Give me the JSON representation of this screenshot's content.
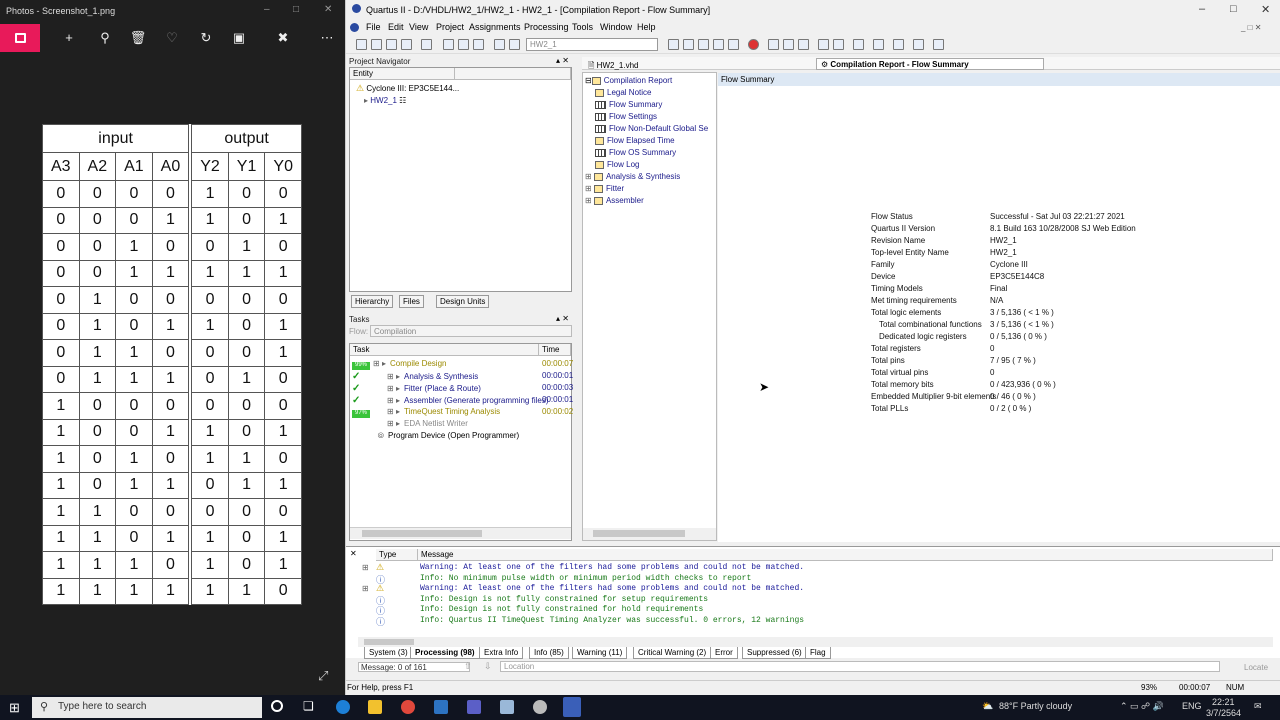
{
  "photos": {
    "title": "Photos - Screenshot_1.png",
    "table": {
      "group_headers": [
        "input",
        "output"
      ],
      "input_cols": [
        "A3",
        "A2",
        "A1",
        "A0"
      ],
      "output_cols": [
        "Y2",
        "Y1",
        "Y0"
      ],
      "rows": [
        [
          "0",
          "0",
          "0",
          "0",
          "1",
          "0",
          "0"
        ],
        [
          "0",
          "0",
          "0",
          "1",
          "1",
          "0",
          "1"
        ],
        [
          "0",
          "0",
          "1",
          "0",
          "0",
          "1",
          "0"
        ],
        [
          "0",
          "0",
          "1",
          "1",
          "1",
          "1",
          "1"
        ],
        [
          "0",
          "1",
          "0",
          "0",
          "0",
          "0",
          "0"
        ],
        [
          "0",
          "1",
          "0",
          "1",
          "1",
          "0",
          "1"
        ],
        [
          "0",
          "1",
          "1",
          "0",
          "0",
          "0",
          "1"
        ],
        [
          "0",
          "1",
          "1",
          "1",
          "0",
          "1",
          "0"
        ],
        [
          "1",
          "0",
          "0",
          "0",
          "0",
          "0",
          "0"
        ],
        [
          "1",
          "0",
          "0",
          "1",
          "1",
          "0",
          "1"
        ],
        [
          "1",
          "0",
          "1",
          "0",
          "1",
          "1",
          "0"
        ],
        [
          "1",
          "0",
          "1",
          "1",
          "0",
          "1",
          "1"
        ],
        [
          "1",
          "1",
          "0",
          "0",
          "0",
          "0",
          "0"
        ],
        [
          "1",
          "1",
          "0",
          "1",
          "1",
          "0",
          "1"
        ],
        [
          "1",
          "1",
          "1",
          "0",
          "1",
          "0",
          "1"
        ],
        [
          "1",
          "1",
          "1",
          "1",
          "1",
          "1",
          "0"
        ]
      ]
    }
  },
  "quartus": {
    "title": "Quartus II - D:/VHDL/HW2_1/HW2_1 - HW2_1 - [Compilation Report - Flow Summary]",
    "menu": [
      "File",
      "Edit",
      "View",
      "Project",
      "Assignments",
      "Processing",
      "Tools",
      "Window",
      "Help"
    ],
    "entity_combo": "HW2_1",
    "nav": {
      "title": "Project Navigator",
      "col_entity": "Entity",
      "device": "Cyclone III: EP3C5E144...",
      "top": "HW2_1",
      "tabs": [
        "Hierarchy",
        "Files",
        "Design Units"
      ]
    },
    "tasks": {
      "title": "Tasks",
      "flow_label": "Flow:",
      "flow_value": "Compilation",
      "col_task": "Task",
      "col_time": "Time",
      "items": [
        {
          "badge": "99%",
          "name": "Compile Design",
          "time": "00:00:07"
        },
        {
          "badge": "",
          "name": "Analysis & Synthesis",
          "time": "00:00:01"
        },
        {
          "badge": "",
          "name": "Fitter (Place & Route)",
          "time": "00:00:03"
        },
        {
          "badge": "",
          "name": "Assembler (Generate programming files)",
          "time": "00:00:01"
        },
        {
          "badge": "97%",
          "name": "TimeQuest Timing Analysis",
          "time": "00:00:02"
        },
        {
          "badge": "",
          "name": "EDA Netlist Writer",
          "time": ""
        },
        {
          "badge": "",
          "name": "Program Device (Open Programmer)",
          "time": ""
        }
      ]
    },
    "doc_tabs": {
      "file": "HW2_1.vhd",
      "report": "Compilation Report - Flow Summary"
    },
    "report_tree": {
      "root": "Compilation Report",
      "items": [
        "Legal Notice",
        "Flow Summary",
        "Flow Settings",
        "Flow Non-Default Global Se",
        "Flow Elapsed Time",
        "Flow OS Summary",
        "Flow Log",
        "Analysis & Synthesis",
        "Fitter",
        "Assembler"
      ]
    },
    "summary": {
      "header": "Flow Summary",
      "rows": [
        [
          "Flow Status",
          "Successful - Sat Jul 03 22:21:27 2021"
        ],
        [
          "Quartus II Version",
          "8.1 Build 163 10/28/2008 SJ Web Edition"
        ],
        [
          "Revision Name",
          "HW2_1"
        ],
        [
          "Top-level Entity Name",
          "HW2_1"
        ],
        [
          "Family",
          "Cyclone III"
        ],
        [
          "Device",
          "EP3C5E144C8"
        ],
        [
          "Timing Models",
          "Final"
        ],
        [
          "Met timing requirements",
          "N/A"
        ],
        [
          "Total logic elements",
          "3 / 5,136 ( < 1 % )"
        ],
        [
          "Total combinational functions",
          "3 / 5,136 ( < 1 % )"
        ],
        [
          "Dedicated logic registers",
          "0 / 5,136 ( 0 % )"
        ],
        [
          "Total registers",
          "0"
        ],
        [
          "Total pins",
          "7 / 95 ( 7 % )"
        ],
        [
          "Total virtual pins",
          "0"
        ],
        [
          "Total memory bits",
          "0 / 423,936 ( 0 % )"
        ],
        [
          "Embedded Multiplier 9-bit elements",
          "0 / 46 ( 0 % )"
        ],
        [
          "Total PLLs",
          "0 / 2 ( 0 % )"
        ]
      ]
    },
    "messages": {
      "col_type": "Type",
      "col_message": "Message",
      "lines": [
        {
          "kind": "w",
          "text": "Warning: At least one of the filters had some problems and could not be matched."
        },
        {
          "kind": "i",
          "text": "Info: No minimum pulse width or minimum period width checks to report"
        },
        {
          "kind": "w",
          "text": "Warning: At least one of the filters had some problems and could not be matched."
        },
        {
          "kind": "i",
          "text": "Info: Design is not fully constrained for setup requirements"
        },
        {
          "kind": "i",
          "text": "Info: Design is not fully constrained for hold requirements"
        },
        {
          "kind": "i",
          "text": "Info: Quartus II TimeQuest Timing Analyzer was successful. 0 errors, 12 warnings"
        }
      ],
      "tabs": [
        "System (3)",
        "Processing (98)",
        "Extra Info",
        "Info (85)",
        "Warning (11)",
        "Critical Warning (2)",
        "Error",
        "Suppressed (6)",
        "Flag"
      ],
      "counter": "Message: 0 of 161",
      "location_placeholder": "Location",
      "locate": "Locate"
    },
    "status": {
      "help": "For Help, press F1",
      "zoom": "93%",
      "time": "00:00:07",
      "num": "NUM"
    }
  },
  "taskbar": {
    "search_placeholder": "Type here to search",
    "weather": "88°F  Partly cloudy",
    "lang": "ENG",
    "time": "22:21",
    "date": "3/7/2564"
  }
}
